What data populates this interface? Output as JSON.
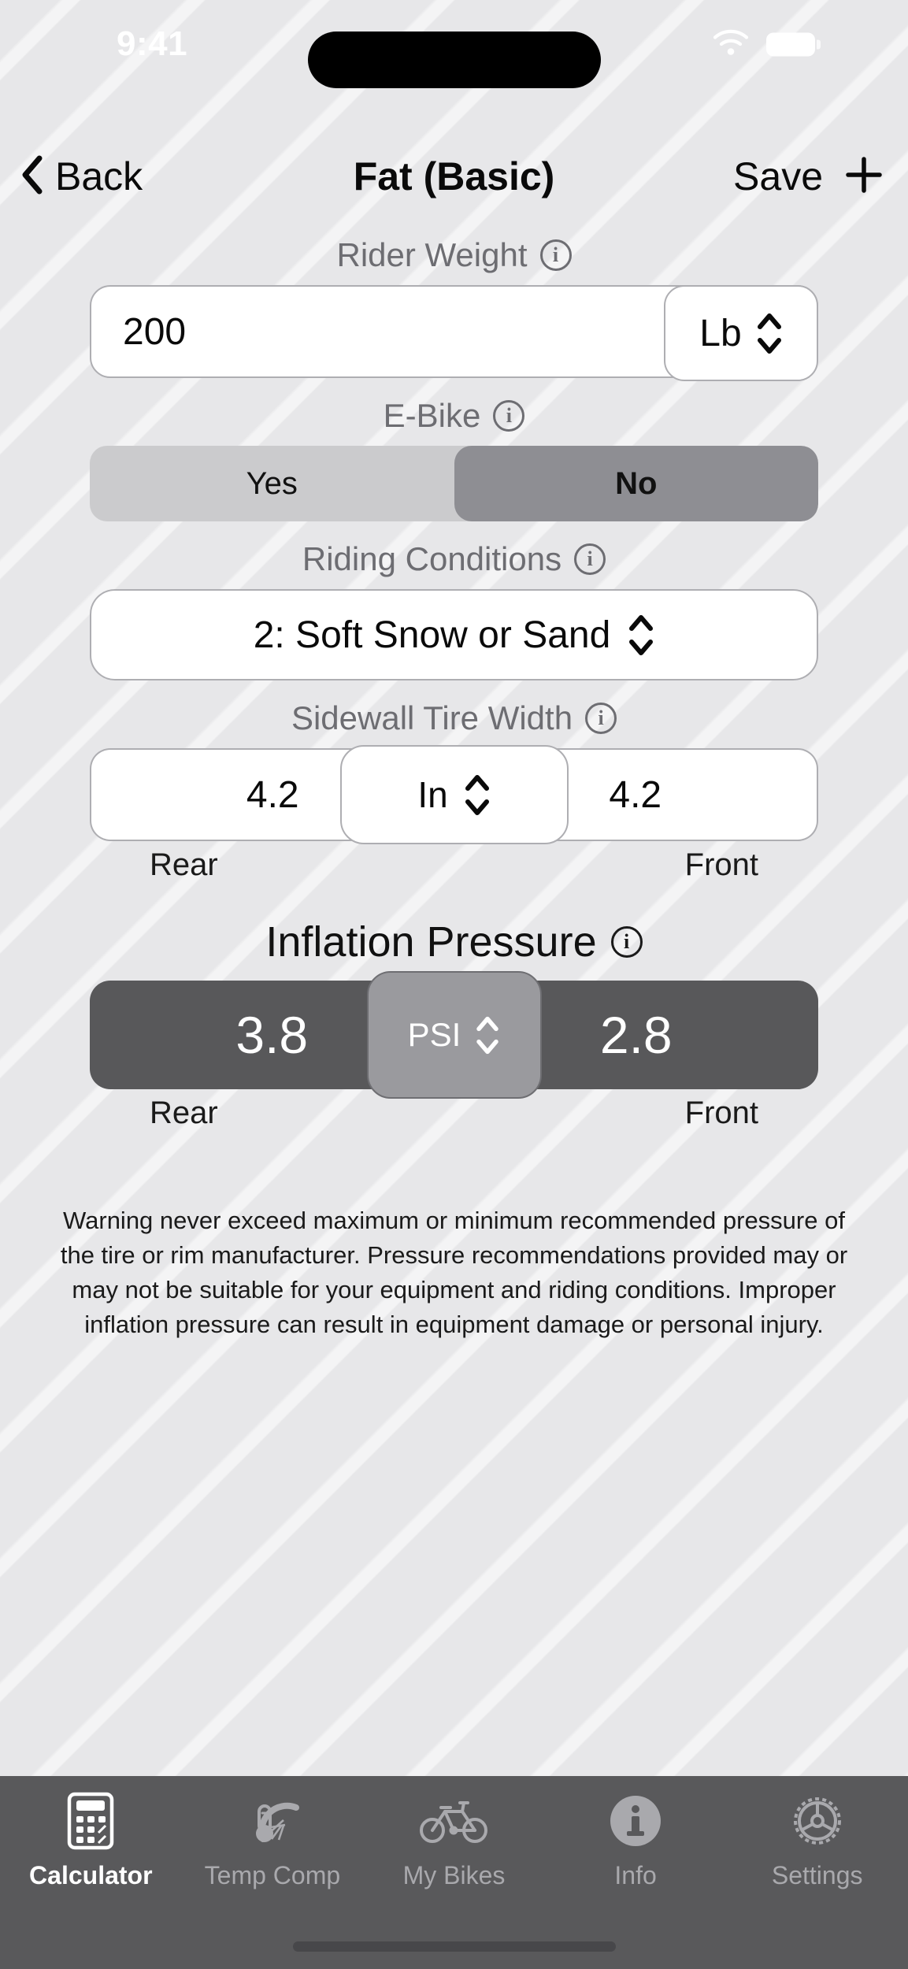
{
  "status_bar": {
    "time": "9:41",
    "wifi_icon": "wifi-icon",
    "battery_icon": "battery-icon"
  },
  "nav_bar": {
    "back_label": "Back",
    "back_icon": "chevron-left-icon",
    "title": "Fat (Basic)",
    "save_label": "Save",
    "add_icon": "plus-icon"
  },
  "form": {
    "rider_weight": {
      "label": "Rider Weight",
      "info_icon": "info-icon",
      "value": "200",
      "unit": "Lb",
      "stepper_icon": "chevron-up-down-icon"
    },
    "ebike": {
      "label": "E-Bike",
      "info_icon": "info-icon",
      "options": [
        "Yes",
        "No"
      ],
      "selected": "No"
    },
    "riding_conditions": {
      "label": "Riding Conditions",
      "info_icon": "info-icon",
      "value": "2: Soft Snow or Sand",
      "stepper_icon": "chevron-up-down-icon"
    },
    "tire_width": {
      "label": "Sidewall Tire Width",
      "info_icon": "info-icon",
      "rear_value": "4.2",
      "front_value": "4.2",
      "unit": "In",
      "rear_caption": "Rear",
      "front_caption": "Front",
      "stepper_icon": "chevron-up-down-icon"
    }
  },
  "result": {
    "label": "Inflation Pressure",
    "info_icon": "info-icon",
    "rear_value": "3.8",
    "front_value": "2.8",
    "unit": "PSI",
    "rear_caption": "Rear",
    "front_caption": "Front",
    "stepper_icon": "chevron-up-down-icon"
  },
  "warning": "Warning never exceed maximum or minimum recommended pressure of the tire or rim manufacturer. Pressure recommendations provided may or may not be suitable for your equipment and riding conditions. Improper inflation pressure can result in equipment damage or personal injury.",
  "tab_bar": {
    "tabs": [
      {
        "label": "Calculator",
        "icon": "calculator-icon",
        "active": true
      },
      {
        "label": "Temp Comp",
        "icon": "thermometer-wheel-icon",
        "active": false
      },
      {
        "label": "My Bikes",
        "icon": "bicycle-icon",
        "active": false
      },
      {
        "label": "Info",
        "icon": "info-circle-icon",
        "active": false
      },
      {
        "label": "Settings",
        "icon": "chainring-gear-icon",
        "active": false
      }
    ]
  },
  "colors": {
    "background": "#E7E7E9",
    "tabbar_background": "#59595B",
    "result_bar": "#58585A",
    "result_unit": "#9A9A9E",
    "segment_track": "#CBCBCD",
    "segment_selected": "#8E8E93",
    "label_text": "#6D6D72",
    "active_tab_text": "#FFFFFF",
    "inactive_tab_text": "#A9A9AD"
  }
}
